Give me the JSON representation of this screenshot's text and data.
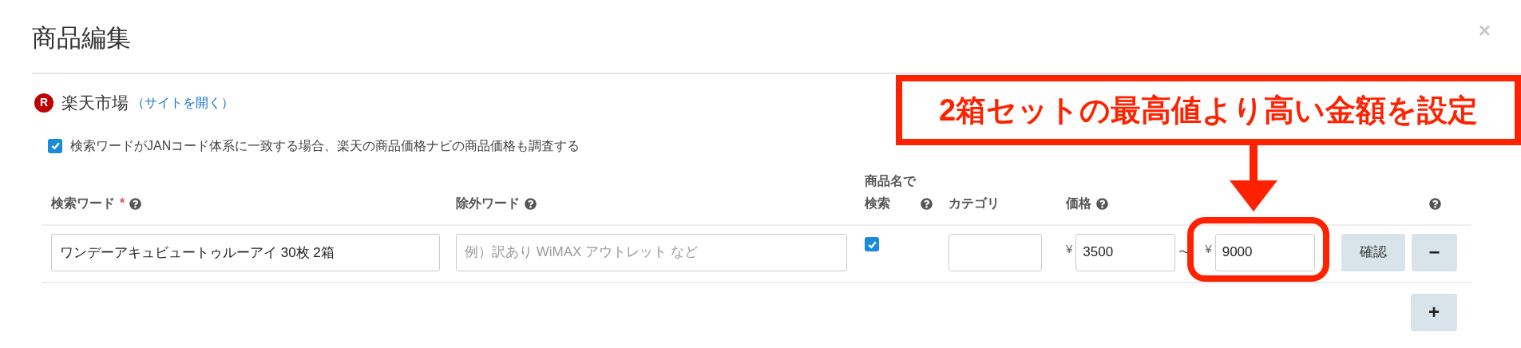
{
  "dialog": {
    "title": "商品編集",
    "close": "×"
  },
  "site": {
    "logo": "R",
    "name": "楽天市場",
    "link": "（サイトを開く）"
  },
  "jan_option": {
    "label": "検索ワードがJANコード体系に一致する場合、楽天の商品価格ナビの商品価格も調査する",
    "checked": true
  },
  "table": {
    "columns": [
      {
        "kind": "search",
        "label": "検索ワード",
        "required_mark": "*",
        "help": true
      },
      {
        "kind": "exclude",
        "label": "除外ワード",
        "help": true
      },
      {
        "kind": "name_search",
        "label_lines": [
          "商品名で",
          "検索"
        ],
        "help": true
      },
      {
        "kind": "category",
        "label": "カテゴリ",
        "help": false
      },
      {
        "kind": "price",
        "label": "価格",
        "help": true
      },
      {
        "kind": "actions",
        "help": true
      }
    ],
    "rows": [
      {
        "search_word": "ワンデーアキュビュートゥルーアイ 30枚 2箱",
        "exclude_placeholder": "例）訳あり WiMAX アウトレット など",
        "name_search": true,
        "currency_min": "¥",
        "price_min": "3500",
        "range_sep": "〜",
        "currency_max": "¥",
        "price_max": "9000",
        "confirm": "確認",
        "remove": "−"
      }
    ]
  },
  "add_row": "+",
  "annotation": {
    "text": "2箱セットの最高値より高い金額を設定"
  }
}
